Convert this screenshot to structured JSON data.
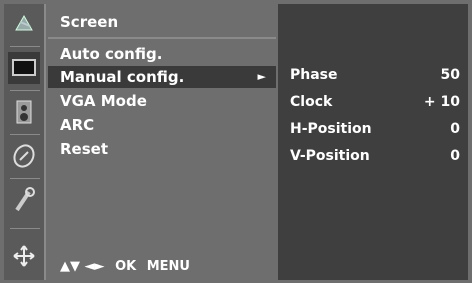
{
  "menu": {
    "title": "Screen",
    "items": [
      {
        "label": "Auto config."
      },
      {
        "label": "Manual config.",
        "arrow": "►"
      },
      {
        "label": "VGA Mode"
      },
      {
        "label": "ARC"
      },
      {
        "label": "Reset"
      }
    ],
    "hint": {
      "nav": "▲▼ ◄►",
      "ok": "OK",
      "menu": "MENU"
    }
  },
  "submenu": {
    "rows": [
      {
        "label": "Phase",
        "value": "50"
      },
      {
        "label": "Clock",
        "value": "+ 10"
      },
      {
        "label": "H-Position",
        "value": "0"
      },
      {
        "label": "V-Position",
        "value": "0"
      }
    ]
  },
  "icons": [
    "picture-icon",
    "screen-icon",
    "audio-icon",
    "time-icon",
    "option-icon",
    "input-icon"
  ],
  "colors": {
    "panel": "#6e6e6e",
    "selected": "#3a3a3a",
    "submenu": "#3f3f3f",
    "text": "#ffffff"
  }
}
